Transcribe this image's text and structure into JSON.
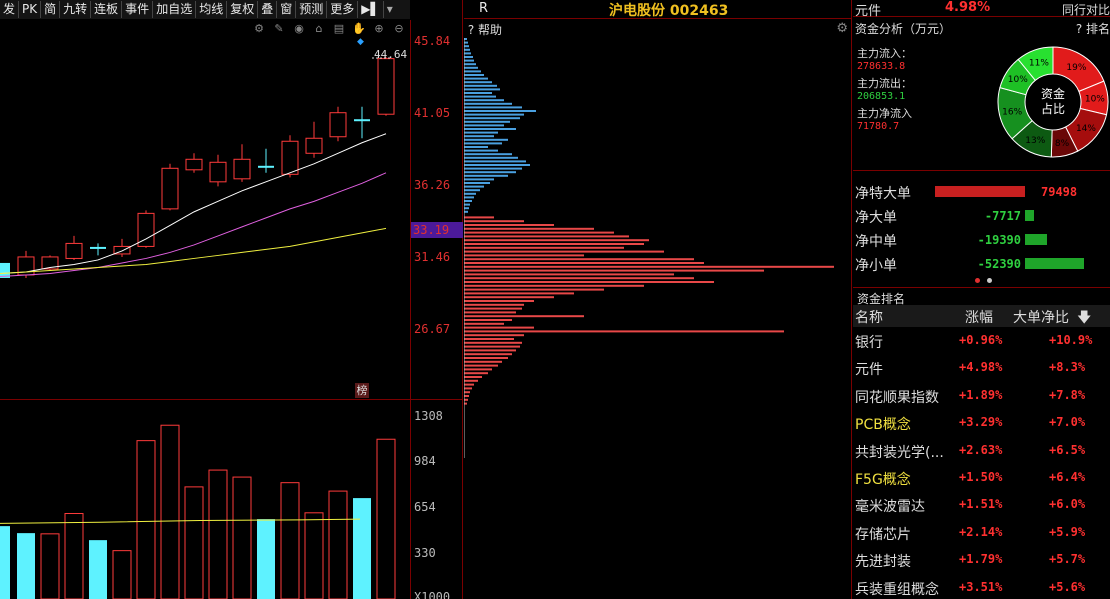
{
  "toolbar": {
    "items": [
      "发",
      "PK",
      "简",
      "九转",
      "连板",
      "事件",
      "加自选",
      "均线",
      "复权",
      "叠",
      "窗",
      "预测",
      "更多"
    ],
    "extra_icon": "pin-icon"
  },
  "chart_icons": [
    "settings-icon",
    "pen-icon",
    "eye-icon",
    "basket-icon",
    "trash-icon",
    "hand-icon",
    "zoom-in-icon",
    "zoom-out-icon"
  ],
  "price_axis": {
    "ticks": [
      "45.84",
      "41.05",
      "36.26",
      "31.46",
      "26.67"
    ],
    "last_price": "33.19"
  },
  "high_marker": "44.64",
  "bang_label": "榜",
  "volume_axis": {
    "ticks": [
      "1308",
      "984",
      "654",
      "330",
      "X1000"
    ]
  },
  "candles": [
    {
      "o": 30.2,
      "c": 31.4,
      "h": 31.8,
      "l": 30.0,
      "up": false
    },
    {
      "o": 30.6,
      "c": 31.4,
      "h": 31.5,
      "l": 30.5,
      "up": true
    },
    {
      "o": 31.3,
      "c": 32.3,
      "h": 32.8,
      "l": 31.2,
      "up": true
    },
    {
      "o": 32.0,
      "c": 32.0,
      "h": 32.3,
      "l": 31.5,
      "up": false
    },
    {
      "o": 31.6,
      "c": 32.1,
      "h": 32.6,
      "l": 31.4,
      "up": true
    },
    {
      "o": 32.1,
      "c": 34.3,
      "h": 34.5,
      "l": 32.0,
      "up": true
    },
    {
      "o": 34.6,
      "c": 37.3,
      "h": 37.6,
      "l": 34.5,
      "up": true
    },
    {
      "o": 37.2,
      "c": 37.9,
      "h": 38.3,
      "l": 37.0,
      "up": true
    },
    {
      "o": 36.4,
      "c": 37.7,
      "h": 38.2,
      "l": 36.1,
      "up": true
    },
    {
      "o": 36.6,
      "c": 37.9,
      "h": 38.9,
      "l": 36.4,
      "up": true
    },
    {
      "o": 37.4,
      "c": 37.4,
      "h": 38.6,
      "l": 37.0,
      "up": false
    },
    {
      "o": 36.9,
      "c": 39.1,
      "h": 39.5,
      "l": 36.7,
      "up": true
    },
    {
      "o": 38.3,
      "c": 39.3,
      "h": 40.4,
      "l": 38.0,
      "up": true
    },
    {
      "o": 39.4,
      "c": 41.0,
      "h": 41.4,
      "l": 39.1,
      "up": true
    },
    {
      "o": 40.5,
      "c": 40.5,
      "h": 41.4,
      "l": 39.3,
      "up": false
    },
    {
      "o": 40.9,
      "c": 44.6,
      "h": 44.7,
      "l": 40.8,
      "up": true
    }
  ],
  "ma_lines": {
    "ma5": [
      30.4,
      30.7,
      30.9,
      31.2,
      31.8,
      32.6,
      33.5,
      34.4,
      35.1,
      35.8,
      36.4,
      37.0,
      37.6,
      38.3,
      39.0,
      39.6
    ],
    "ma10": [
      30.2,
      30.3,
      30.5,
      30.7,
      31.0,
      31.3,
      31.7,
      32.2,
      32.8,
      33.4,
      34.0,
      34.6,
      35.1,
      35.7,
      36.3,
      37.0
    ],
    "ma20": [
      30.4,
      30.5,
      30.6,
      30.7,
      30.8,
      30.9,
      31.1,
      31.3,
      31.5,
      31.7,
      31.9,
      32.1,
      32.4,
      32.7,
      33.0,
      33.3
    ]
  },
  "volumes": [
    {
      "v": 470,
      "up": false
    },
    {
      "v": 465,
      "up": true
    },
    {
      "v": 610,
      "up": true
    },
    {
      "v": 420,
      "up": false
    },
    {
      "v": 345,
      "up": true
    },
    {
      "v": 1130,
      "up": true
    },
    {
      "v": 1240,
      "up": true
    },
    {
      "v": 800,
      "up": true
    },
    {
      "v": 920,
      "up": true
    },
    {
      "v": 870,
      "up": true
    },
    {
      "v": 570,
      "up": false
    },
    {
      "v": 830,
      "up": true
    },
    {
      "v": 615,
      "up": true
    },
    {
      "v": 770,
      "up": true
    },
    {
      "v": 720,
      "up": false
    },
    {
      "v": 1140,
      "up": true
    }
  ],
  "mid": {
    "r_label": "R",
    "stock_title": "沪电股份 002463",
    "help_label": "帮助"
  },
  "right": {
    "header_name": "元件",
    "header_pct": "4.98%",
    "header_compare": "同行对比",
    "flow_title": "资金分析（万元）",
    "rank_link": "? 排名",
    "inflow_label": "主力流入：",
    "inflow_value": "278633.8",
    "outflow_label": "主力流出：",
    "outflow_value": "206853.1",
    "net_label": "主力净流入",
    "net_value": "71780.7",
    "donut_center": [
      "资金",
      "占比"
    ],
    "donut": [
      {
        "pct": 19,
        "label": "19%",
        "color": "#e11b1b"
      },
      {
        "pct": 10,
        "label": "10%",
        "color": "#e11b1b"
      },
      {
        "pct": 14,
        "label": "14%",
        "color": "#a50d0d"
      },
      {
        "pct": 8,
        "label": "8%",
        "color": "#6a0707"
      },
      {
        "pct": 13,
        "label": "13%",
        "color": "#0d5a12"
      },
      {
        "pct": 16,
        "label": "16%",
        "color": "#16901f"
      },
      {
        "pct": 10,
        "label": "10%",
        "color": "#1ec025"
      },
      {
        "pct": 11,
        "label": "11%",
        "color": "#28e030"
      }
    ],
    "net_rows": [
      {
        "label": "净特大单",
        "value": "79498",
        "amount": 79498,
        "color": "#c82020"
      },
      {
        "label": "净大单",
        "value": "-7717",
        "amount": -7717,
        "color": "#1fa52a"
      },
      {
        "label": "净中单",
        "value": "-19390",
        "amount": -19390,
        "color": "#1fa52a"
      },
      {
        "label": "净小单",
        "value": "-52390",
        "amount": -52390,
        "color": "#1fa52a"
      }
    ],
    "rank_title": "资金排名",
    "rank_headers": [
      "名称",
      "涨幅",
      "大单净比"
    ],
    "sort_icon": "sort-down-icon",
    "rank_rows": [
      {
        "name": "银行",
        "change": "+0.96%",
        "ratio": "+10.9%",
        "hl": false
      },
      {
        "name": "元件",
        "change": "+4.98%",
        "ratio": "+8.3%",
        "hl": false
      },
      {
        "name": "同花顺果指数",
        "change": "+1.89%",
        "ratio": "+7.8%",
        "hl": false
      },
      {
        "name": "PCB概念",
        "change": "+3.29%",
        "ratio": "+7.0%",
        "hl": true
      },
      {
        "name": "共封装光学(...",
        "change": "+2.63%",
        "ratio": "+6.5%",
        "hl": false
      },
      {
        "name": "F5G概念",
        "change": "+1.50%",
        "ratio": "+6.4%",
        "hl": true
      },
      {
        "name": "毫米波雷达",
        "change": "+1.51%",
        "ratio": "+6.0%",
        "hl": false
      },
      {
        "name": "存储芯片",
        "change": "+2.14%",
        "ratio": "+5.9%",
        "hl": false
      },
      {
        "name": "先进封装",
        "change": "+1.79%",
        "ratio": "+5.7%",
        "hl": false
      },
      {
        "name": "兵装重组概念",
        "change": "+3.51%",
        "ratio": "+5.6%",
        "hl": false
      }
    ]
  }
}
